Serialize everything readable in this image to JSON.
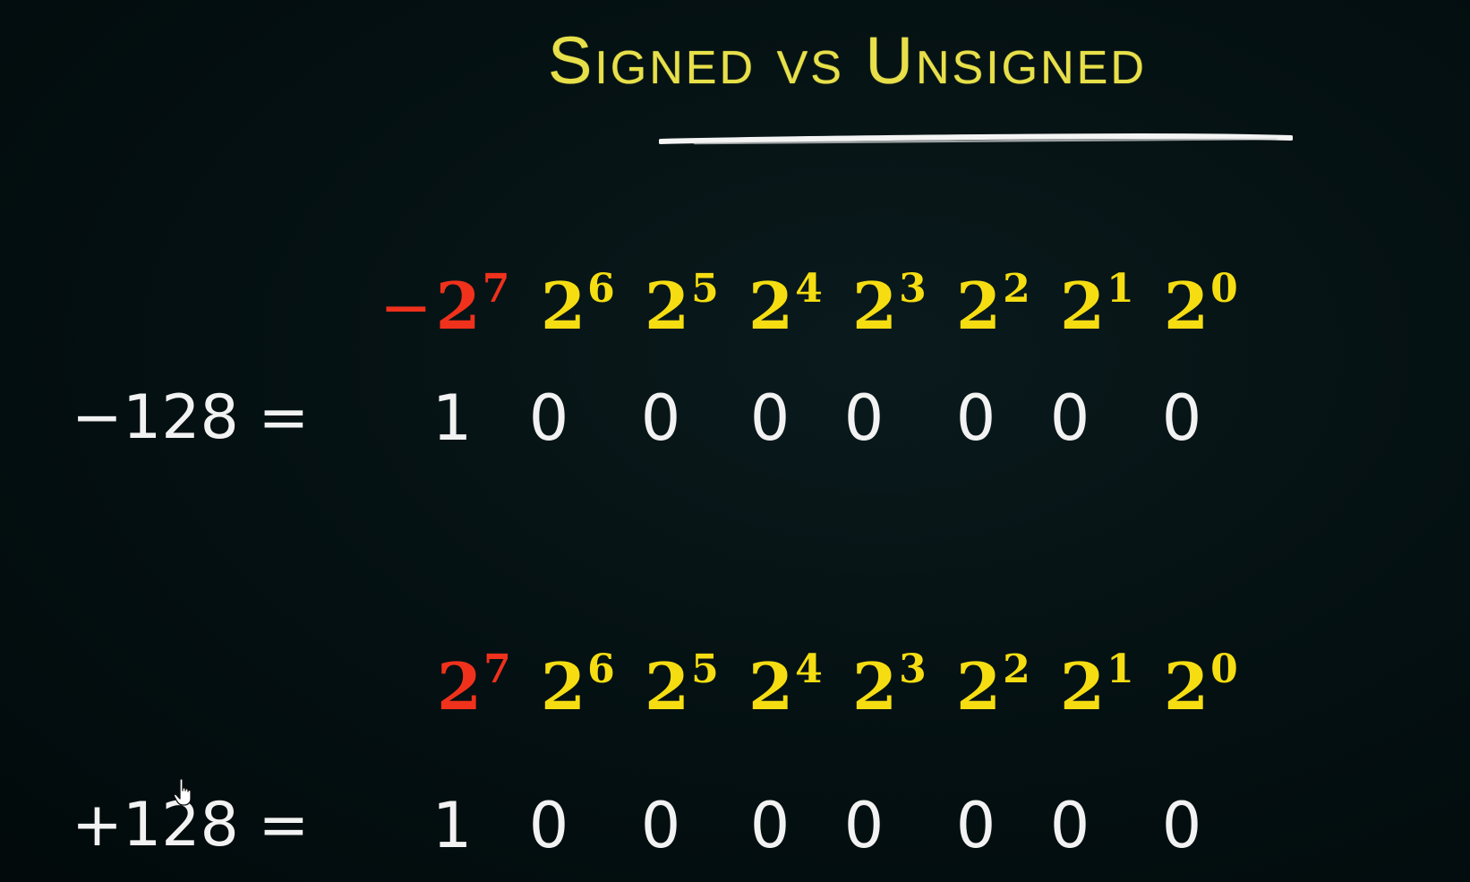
{
  "title": "Signed vs Unsigned",
  "colors": {
    "title": "#e8e04a",
    "msb": "#f0311c",
    "power": "#f5dd12",
    "bits": "#f2f2f2",
    "underline": "#f4f4f4"
  },
  "signed": {
    "label": "−128 =",
    "neg_sign": "−",
    "powers": [
      {
        "base": "2",
        "exp": "7"
      },
      {
        "base": "2",
        "exp": "6"
      },
      {
        "base": "2",
        "exp": "5"
      },
      {
        "base": "2",
        "exp": "4"
      },
      {
        "base": "2",
        "exp": "3"
      },
      {
        "base": "2",
        "exp": "2"
      },
      {
        "base": "2",
        "exp": "1"
      },
      {
        "base": "2",
        "exp": "0"
      }
    ],
    "bits": [
      "1",
      "0",
      "0",
      "0",
      "0",
      "0",
      "0",
      "0"
    ]
  },
  "unsigned": {
    "label": "+128 =",
    "powers": [
      {
        "base": "2",
        "exp": "7"
      },
      {
        "base": "2",
        "exp": "6"
      },
      {
        "base": "2",
        "exp": "5"
      },
      {
        "base": "2",
        "exp": "4"
      },
      {
        "base": "2",
        "exp": "3"
      },
      {
        "base": "2",
        "exp": "2"
      },
      {
        "base": "2",
        "exp": "1"
      },
      {
        "base": "2",
        "exp": "0"
      }
    ],
    "bits": [
      "1",
      "0",
      "0",
      "0",
      "0",
      "0",
      "0",
      "0"
    ]
  },
  "cursor_icon": "hand-pointer-icon"
}
